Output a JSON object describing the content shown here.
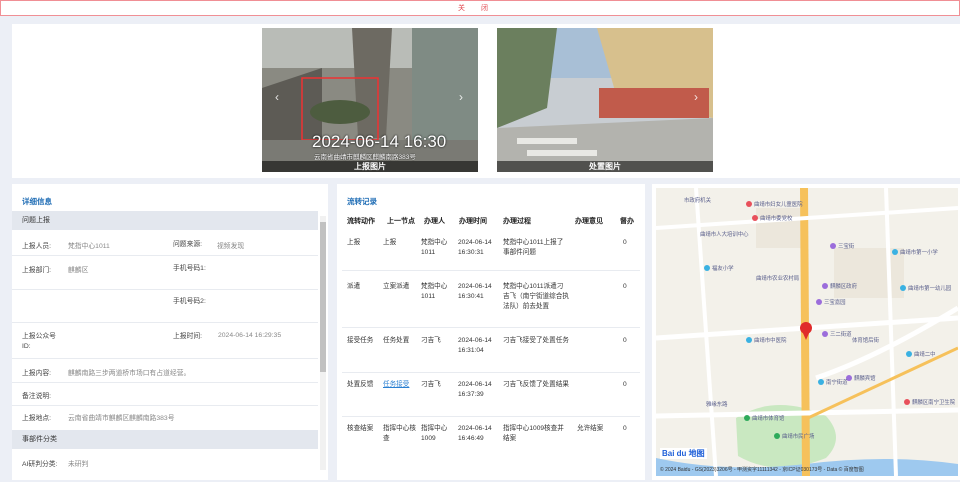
{
  "topbar": {
    "close_label": "关闭"
  },
  "photos": {
    "report_caption": "上报图片",
    "disposal_caption": "处置图片",
    "stamp_date": "2024-06-14 16:30",
    "stamp_addr": "云南省曲靖市麒麟区麒麟南路383号"
  },
  "detail": {
    "title": "详细信息",
    "group_report": "问题上报",
    "reporter_label": "上报人员:",
    "reporter_value": "梵指中心1011",
    "source_label": "问题来源:",
    "source_value": "视频发现",
    "dept_label": "上报部门:",
    "dept_value": "麒麟区",
    "phone1_label": "手机号码1:",
    "phone2_label": "手机号码2:",
    "public_id_label": "上报公众号ID:",
    "time_label": "上报时间:",
    "time_value": "2024-06-14 16:29:35",
    "content_label": "上报内容:",
    "content_value": "麒麟南路三步两道桥市场口有占道经营。",
    "remark_label": "备注说明:",
    "place_label": "上报地点:",
    "place_value": "云南省曲靖市麒麟区麒麟南路383号",
    "group_class": "事部件分类",
    "ai_label": "AI研判分类:",
    "ai_value": "未研判"
  },
  "flow": {
    "title": "流转记录",
    "headers": [
      "流转动作",
      "上一节点",
      "办理人",
      "办理时间",
      "办理过程",
      "办理意见",
      "督办"
    ],
    "rows": [
      {
        "action": "上报",
        "prev": "上报",
        "handler": "梵指中心1011",
        "time": "2024-06-14 16:30:31",
        "process": "梵指中心1011上报了事部件问题",
        "opinion": "",
        "supervise": "0"
      },
      {
        "action": "派遣",
        "prev": "立案派遣",
        "handler": "梵指中心1011",
        "time": "2024-06-14 16:30:41",
        "process": "梵指中心1011派遣刁吉飞（南宁街道综合执法队）前去处置",
        "opinion": "",
        "supervise": "0"
      },
      {
        "action": "接受任务",
        "prev": "任务处置",
        "handler": "刁吉飞",
        "time": "2024-06-14 16:31:04",
        "process": "刁吉飞接受了处置任务",
        "opinion": "",
        "supervise": "0"
      },
      {
        "action": "处置反馈",
        "prev": "任务接受",
        "handler": "刁吉飞",
        "time": "2024-06-14 16:37:39",
        "process": "刁吉飞反馈了处置结果",
        "opinion": "",
        "supervise": "0"
      },
      {
        "action": "核查结案",
        "prev": "指挥中心核查",
        "handler": "指挥中心1009",
        "time": "2024-06-14 16:46:49",
        "process": "指挥中心1009核查并结案",
        "opinion": "允许结案",
        "supervise": "0"
      }
    ]
  },
  "map": {
    "logo": "Bai du 地图",
    "copyright": "© 2024 Baidu - GS(2023)3206号 - 甲测资字11111342 - 京ICP证030173号 - Data © 百度智图",
    "pois": [
      "市政府机关",
      "曲靖市委党校",
      "曲靖市妇女儿童医院",
      "曲靖市人大培训中心",
      "曲靖市第一小学",
      "福友小学",
      "曲靖市农业农村局",
      "三宝街",
      "麒麟区政府",
      "三二街道",
      "曲靖市中医院",
      "曲靖市第一幼儿园",
      "三宝嘉园",
      "曲靖二中",
      "曲靖市体育馆",
      "体育馆后街",
      "麒麟宾馆",
      "雅缘东路",
      "麒麟区南宁卫生院",
      "南宁街道",
      "曲靖市民广场"
    ],
    "accent_colors": {
      "road": "#f6c15b",
      "water": "#9ec9ef",
      "green": "#c9e8c1",
      "marker": "#e02b2b"
    }
  }
}
